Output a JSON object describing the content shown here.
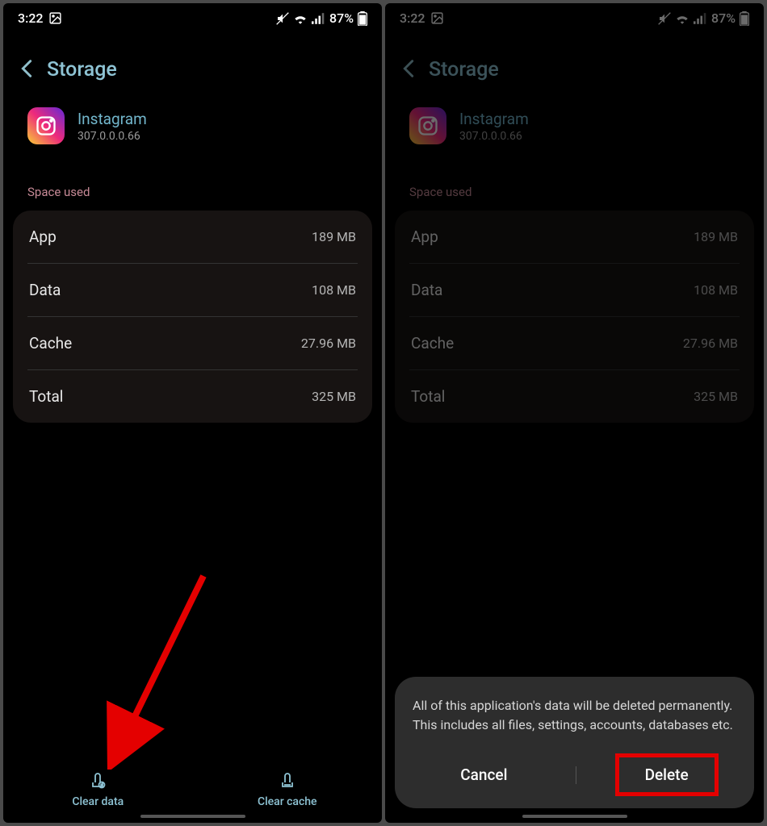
{
  "status": {
    "time": "3:22",
    "battery": "87%"
  },
  "header": {
    "title": "Storage"
  },
  "app": {
    "name": "Instagram",
    "version": "307.0.0.0.66"
  },
  "section": {
    "space_used": "Space used"
  },
  "rows": {
    "app": {
      "label": "App",
      "value": "189 MB"
    },
    "data": {
      "label": "Data",
      "value": "108 MB"
    },
    "cache": {
      "label": "Cache",
      "value": "27.96 MB"
    },
    "total": {
      "label": "Total",
      "value": "325 MB"
    }
  },
  "actions": {
    "clear_data": "Clear data",
    "clear_cache": "Clear cache"
  },
  "dialog": {
    "text": "All of this application's data will be deleted permanently. This includes all files, settings, accounts, databases etc.",
    "cancel": "Cancel",
    "delete": "Delete"
  }
}
